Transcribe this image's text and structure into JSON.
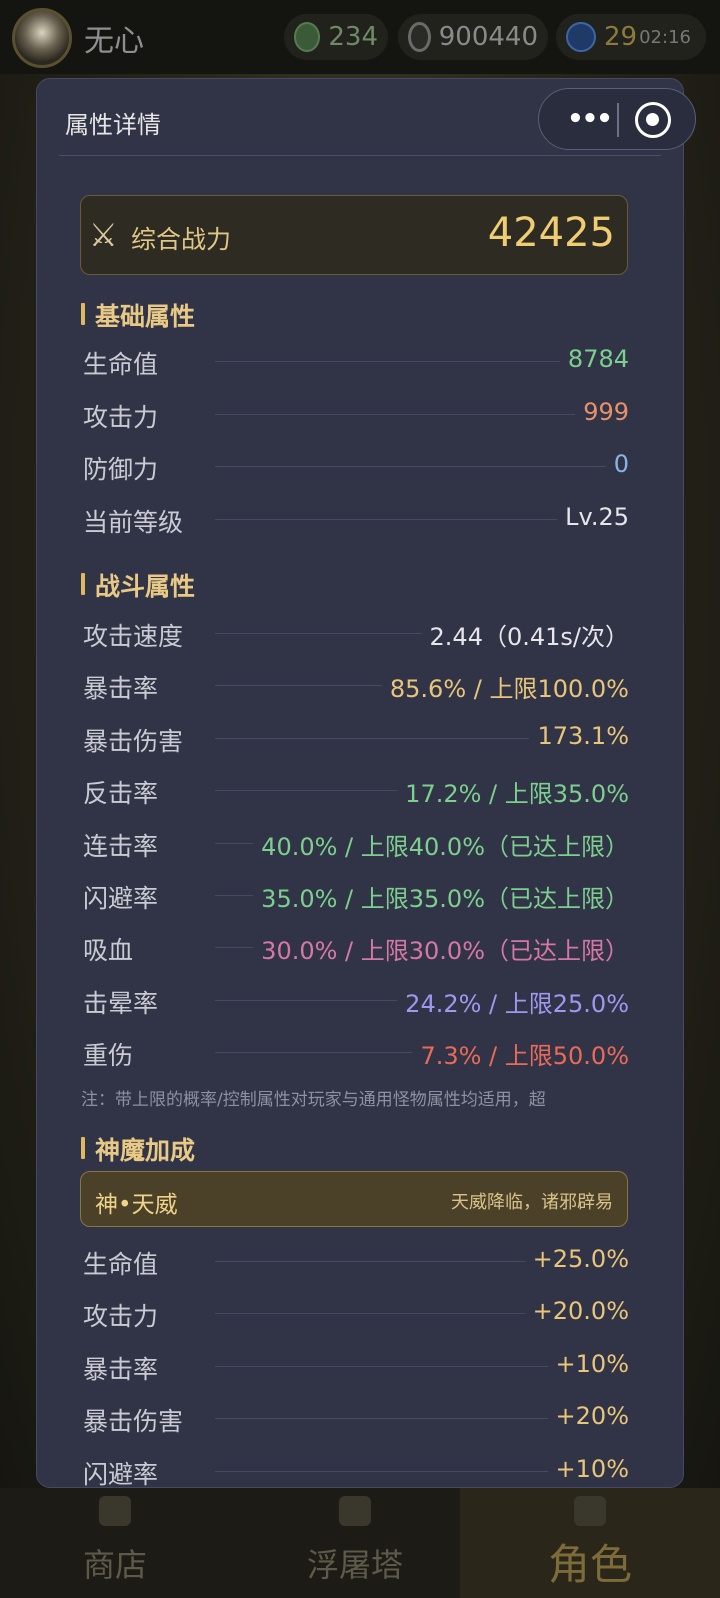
{
  "topbar": {
    "player_name": "无心",
    "jade": "234",
    "coins": "900440",
    "gems": "29",
    "time": "02:16"
  },
  "bottom_nav": [
    {
      "label": "商店"
    },
    {
      "label": "浮屠塔"
    },
    {
      "label": "角色"
    }
  ],
  "modal": {
    "title": "属性详情",
    "power": {
      "icon": "⚔",
      "label": "综合战力",
      "value": "42425"
    },
    "basic": {
      "title": "基础属性",
      "rows": [
        {
          "label": "生命值",
          "value": "8784",
          "color": "#7ccf8e"
        },
        {
          "label": "攻击力",
          "value": "999",
          "color": "#e7916a"
        },
        {
          "label": "防御力",
          "value": "0",
          "color": "#8ab4e8"
        },
        {
          "label": "当前等级",
          "value": "Lv.25",
          "color": "#e6e6ea"
        }
      ]
    },
    "combat": {
      "title": "战斗属性",
      "rows": [
        {
          "label": "攻击速度",
          "value": "2.44（0.41s/次）",
          "color": "#e6e6ea"
        },
        {
          "label": "暴击率",
          "value": "85.6% / 上限100.0%",
          "color": "#e8c57a"
        },
        {
          "label": "暴击伤害",
          "value": "173.1%",
          "color": "#e8c57a"
        },
        {
          "label": "反击率",
          "value": "17.2% / 上限35.0%",
          "color": "#7ccf8e"
        },
        {
          "label": "连击率",
          "value": "40.0% / 上限40.0%（已达上限）",
          "color": "#7ccf8e"
        },
        {
          "label": "闪避率",
          "value": "35.0% / 上限35.0%（已达上限）",
          "color": "#7ccf8e"
        },
        {
          "label": "吸血",
          "value": "30.0% / 上限30.0%（已达上限）",
          "color": "#d678a6"
        },
        {
          "label": "击晕率",
          "value": "24.2% / 上限25.0%",
          "color": "#9f97f0"
        },
        {
          "label": "重伤",
          "value": "7.3% / 上限50.0%",
          "color": "#ea6a5a"
        }
      ],
      "note": "注：带上限的概率/控制属性对玩家与通用怪物属性均适用，超"
    },
    "divine": {
      "title": "神魔加成",
      "blessing_name": "神•天威",
      "blessing_desc": "天威降临，诸邪辟易",
      "rows": [
        {
          "label": "生命值",
          "value": "+25.0%",
          "color": "#e8c57a"
        },
        {
          "label": "攻击力",
          "value": "+20.0%",
          "color": "#e8c57a"
        },
        {
          "label": "暴击率",
          "value": "+10%",
          "color": "#e8c57a"
        },
        {
          "label": "暴击伤害",
          "value": "+20%",
          "color": "#e8c57a"
        },
        {
          "label": "闪避率",
          "value": "+10%",
          "color": "#e8c57a"
        }
      ]
    }
  },
  "icons": {
    "capsule_more": "more-dots-icon",
    "capsule_close": "close-target-icon",
    "power": "crossed-swords-icon"
  }
}
